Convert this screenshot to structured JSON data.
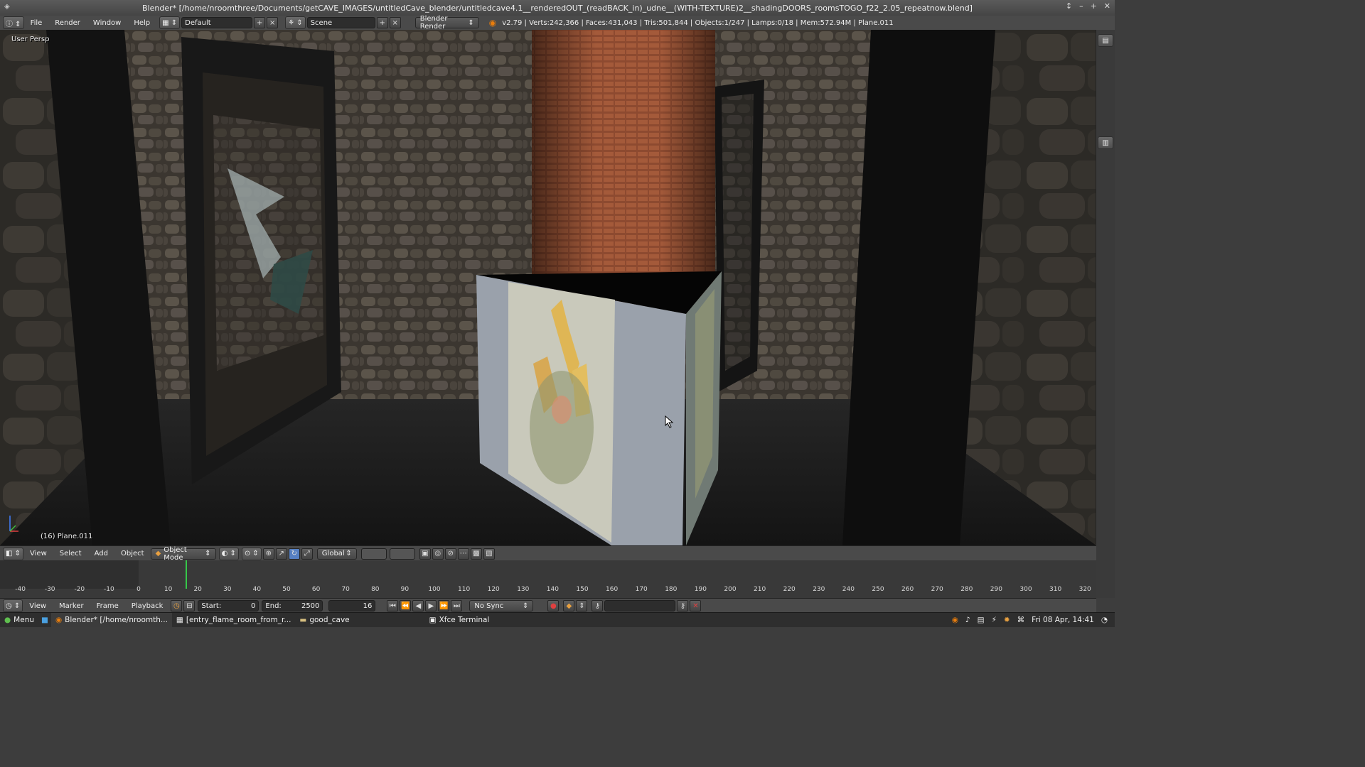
{
  "window": {
    "title": "Blender* [/home/nroomthree/Documents/getCAVE_IMAGES/untitledCave_blender/untitledcave4.1__renderedOUT_(readBACK_in)_udne__(WITH-TEXTURE)2__shadingDOORS_roomsTOGO_f22_2.05_repeatnow.blend]",
    "controls": [
      "↕",
      "–",
      "+",
      "✕"
    ]
  },
  "topbar": {
    "menus": [
      "File",
      "Render",
      "Window",
      "Help"
    ],
    "screen_layout": "Default",
    "scene": "Scene",
    "render_engine": "Blender Render",
    "stats": "v2.79 | Verts:242,366 | Faces:431,043 | Tris:501,844 | Objects:1/247 | Lamps:0/18 | Mem:572.94M | Plane.011"
  },
  "viewport": {
    "view_label": "User Persp",
    "object_label": "(16) Plane.011"
  },
  "viewport_header": {
    "menus": [
      "View",
      "Select",
      "Add",
      "Object"
    ],
    "mode": "Object Mode",
    "orientation": "Global"
  },
  "timeline": {
    "ticks": [
      "-40",
      "-30",
      "-20",
      "-10",
      "0",
      "10",
      "20",
      "30",
      "40",
      "50",
      "60",
      "70",
      "80",
      "90",
      "100",
      "110",
      "120",
      "130",
      "140",
      "150",
      "160",
      "170",
      "180",
      "190",
      "200",
      "210",
      "220",
      "230",
      "240",
      "250",
      "260",
      "270",
      "280",
      "290",
      "300",
      "310",
      "320"
    ],
    "current_frame_tick": 16
  },
  "timeline_header": {
    "menus": [
      "View",
      "Marker",
      "Frame",
      "Playback"
    ],
    "start_label": "Start:",
    "start_value": "0",
    "end_label": "End:",
    "end_value": "2500",
    "current_frame": "16",
    "sync": "No Sync"
  },
  "taskbar": {
    "menu": "Menu",
    "tasks": [
      {
        "label": "Blender* [/home/nroomth...",
        "active": true
      },
      {
        "label": "[entry_flame_room_from_r...",
        "active": false
      },
      {
        "label": "good_cave",
        "active": false
      },
      {
        "label": "Xfce Terminal",
        "active": false
      }
    ],
    "clock": "Fri 08 Apr, 14:41"
  },
  "colors": {
    "accent_orange": "#e87d0d",
    "frame_cursor": "#36c84a",
    "panel": "#4a4a4a"
  }
}
